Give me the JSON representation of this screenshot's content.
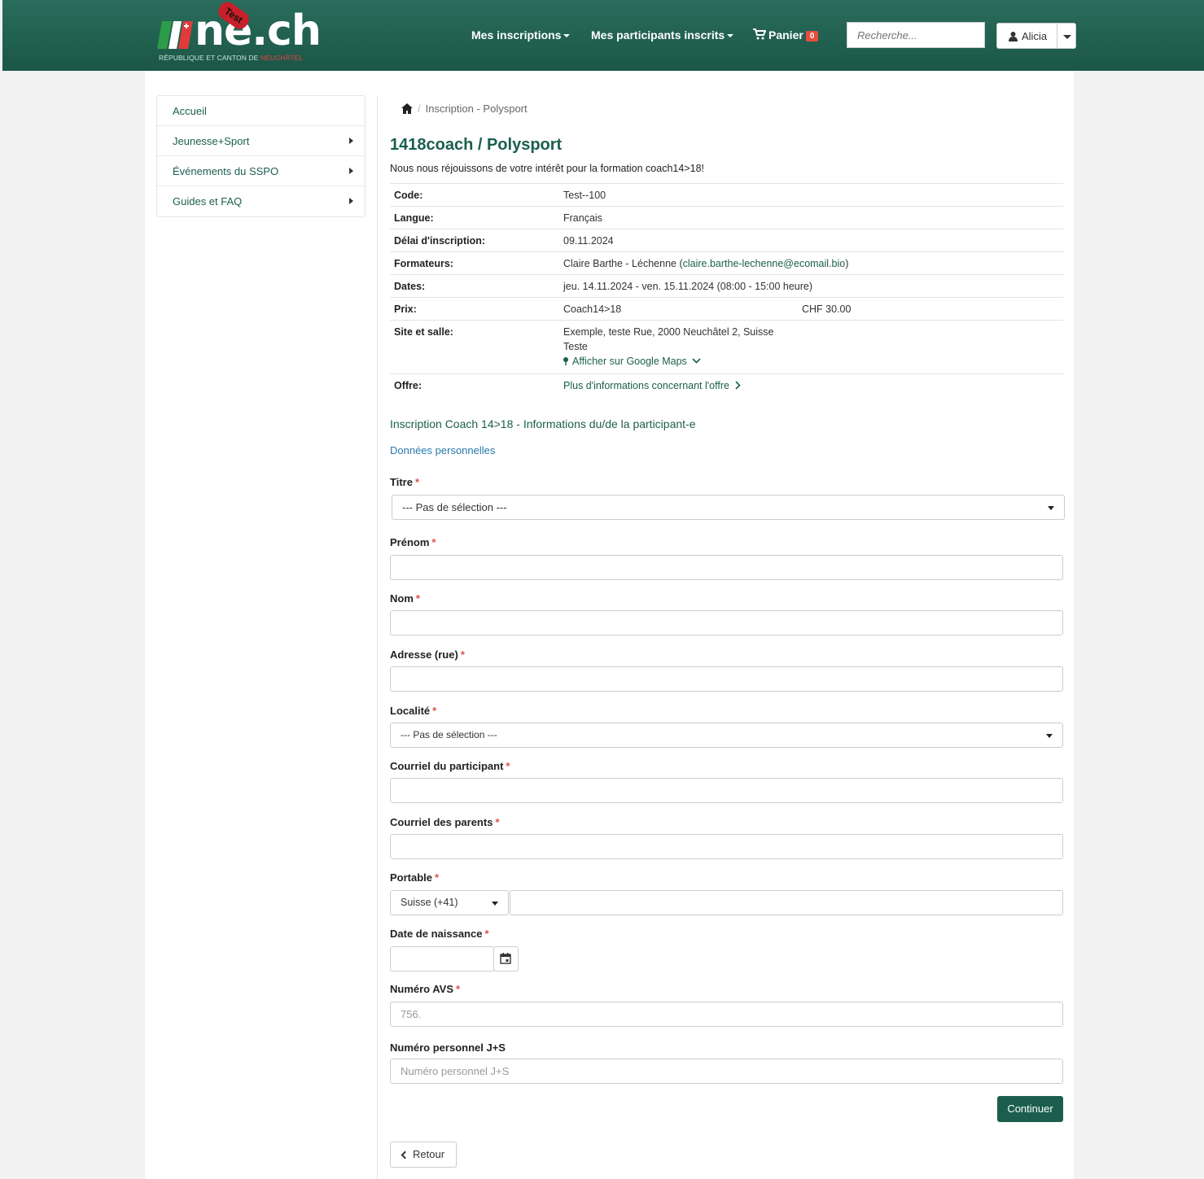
{
  "header": {
    "brand": "ne.ch",
    "brand_badge": "Test",
    "brand_sub_prefix": "RÉPUBLIQUE ET CANTON DE ",
    "brand_sub_highlight": "NEUCHÂTEL",
    "nav": [
      {
        "label": "Mes inscriptions"
      },
      {
        "label": "Mes participants inscrits"
      }
    ],
    "cart_label": "Panier",
    "cart_count": "0",
    "search_placeholder": "Recherche...",
    "user_name": "Alicia"
  },
  "sidebar": {
    "items": [
      {
        "label": "Accueil"
      },
      {
        "label": "Jeunesse+Sport"
      },
      {
        "label": "Événements du SSPO"
      },
      {
        "label": "Guides et FAQ"
      }
    ]
  },
  "breadcrumb": {
    "current": "Inscription - Polysport"
  },
  "course": {
    "title": "1418coach / Polysport",
    "intro": "Nous nous réjouissons de votre intérêt pour la formation coach14>18!",
    "rows": {
      "code_k": "Code:",
      "code_v": "Test--100",
      "langue_k": "Langue:",
      "langue_v": "Français",
      "delai_k": "Délai d'inscription:",
      "delai_v": "09.11.2024",
      "form_k": "Formateurs:",
      "form_name": "Claire Barthe - Léchenne (",
      "form_email": "claire.barthe-lechenne@ecomail.bio",
      "form_close": ")",
      "dates_k": "Dates:",
      "dates_v": "jeu. 14.11.2024 - ven. 15.11.2024 (08:00 - 15:00 heure)",
      "prix_k": "Prix:",
      "prix_name": "Coach14>18",
      "prix_amount": "CHF 30.00",
      "site_k": "Site et salle:",
      "site_addr": "Exemple, teste Rue, 2000 Neuchâtel 2, Suisse",
      "site_room": "Teste",
      "site_map": "Afficher sur Google Maps",
      "offre_k": "Offre:",
      "offre_link": "Plus d'informations concernant l'offre"
    }
  },
  "form": {
    "section_title": "Inscription Coach 14>18 - Informations du/de la participant-e",
    "subsection": "Données personnelles",
    "required_mark": "*",
    "titre_label": "Titre",
    "titre_value": "--- Pas de sélection ---",
    "prenom_label": "Prénom",
    "nom_label": "Nom",
    "adresse_label": "Adresse (rue)",
    "localite_label": "Localité",
    "localite_value": "--- Pas de sélection ---",
    "courriel_part_label": "Courriel du participant",
    "courriel_parents_label": "Courriel des parents",
    "portable_label": "Portable",
    "portable_country": "Suisse (+41)",
    "naissance_label": "Date de naissance",
    "avs_label": "Numéro AVS",
    "avs_placeholder": "756.",
    "js_label": "Numéro personnel J+S",
    "js_placeholder": "Numéro personnel J+S",
    "continue_label": "Continuer",
    "back_label": "Retour"
  },
  "colors": {
    "brand": "#1b5e4e",
    "header_bg": "#226352",
    "required": "#d9534f",
    "badge": "#e74c3c"
  },
  "icons": [
    "swiss-flag-icon",
    "caret-down-icon",
    "cart-icon",
    "user-icon",
    "home-icon",
    "chevron-right-icon",
    "map-pin-icon",
    "calendar-icon",
    "chevron-left-icon"
  ]
}
